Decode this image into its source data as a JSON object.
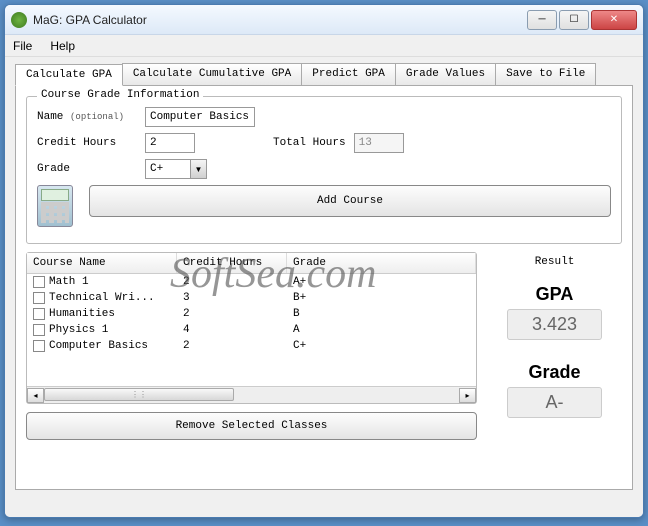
{
  "window": {
    "title": "MaG: GPA Calculator"
  },
  "menu": {
    "file": "File",
    "help": "Help"
  },
  "tabs": {
    "calculate": "Calculate GPA",
    "cumulative": "Calculate Cumulative GPA",
    "predict": "Predict GPA",
    "values": "Grade Values",
    "save": "Save to File"
  },
  "form": {
    "group_title": "Course Grade Information",
    "name_label": "Name",
    "name_optional": "(optional)",
    "name_value": "Computer Basics",
    "hours_label": "Credit Hours",
    "hours_value": "2",
    "total_label": "Total Hours",
    "total_value": "13",
    "grade_label": "Grade",
    "grade_value": "C+",
    "add_button": "Add Course"
  },
  "table": {
    "col1": "Course Name",
    "col2": "Credit Hours",
    "col3": "Grade",
    "rows": [
      {
        "name": "Math 1",
        "hours": "2",
        "grade": "A+"
      },
      {
        "name": "Technical Wri...",
        "hours": "3",
        "grade": "B+"
      },
      {
        "name": "Humanities",
        "hours": "2",
        "grade": "B"
      },
      {
        "name": "Physics 1",
        "hours": "4",
        "grade": "A"
      },
      {
        "name": "Computer Basics",
        "hours": "2",
        "grade": "C+"
      }
    ]
  },
  "result": {
    "title": "Result",
    "gpa_label": "GPA",
    "gpa_value": "3.423",
    "grade_label": "Grade",
    "grade_value": "A-"
  },
  "remove_button": "Remove Selected Classes",
  "watermark": "SoftSea.com"
}
